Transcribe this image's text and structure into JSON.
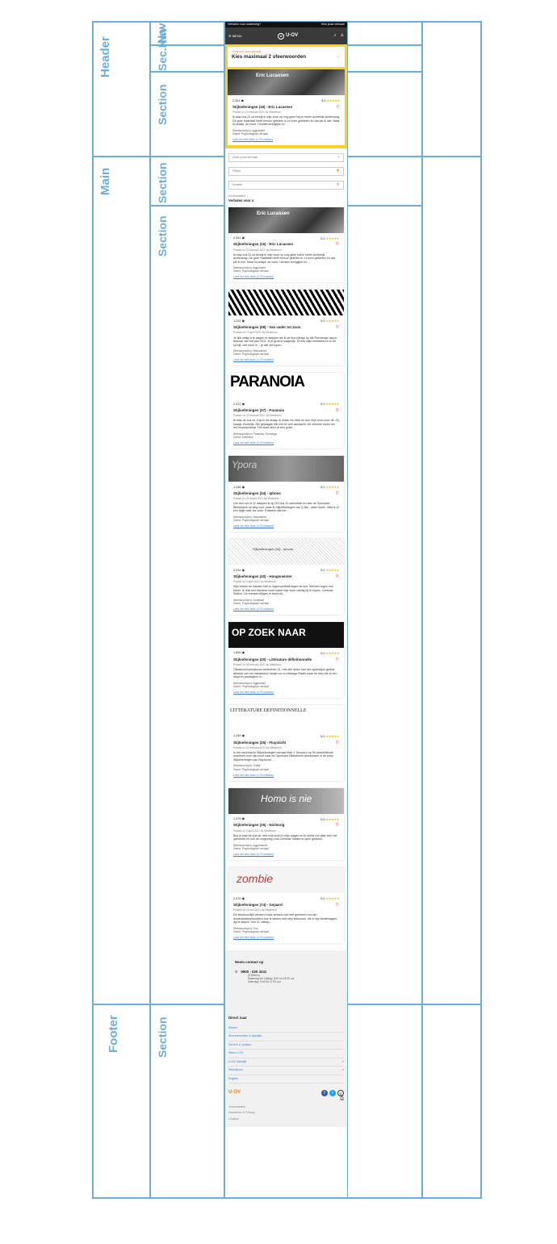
{
  "labels": {
    "header": "Header",
    "main": "Main",
    "footer": "Footer",
    "nav": "Nav",
    "secnav": "Sec.Nav",
    "section": "Section"
  },
  "topbar": {
    "left": "Verhalen voor onderweg?",
    "right": "Kies jouw verhaal!"
  },
  "navbar": {
    "menu": "MENU",
    "logo": "U·OV",
    "icons": [
      "search-icon",
      "user-icon"
    ]
  },
  "picker": {
    "small": "Genereer jouw verhaal",
    "big": "Kies maximaal 2 sfeerwoorden"
  },
  "search": {
    "placeholder": "Zoek jouw verhaal...",
    "filters": "Filters",
    "sort": "Sorteer"
  },
  "results": {
    "count": "54 resultaten",
    "title": "Verhalen voor u"
  },
  "featured": {
    "views": "2.341",
    "rating": "5.0",
    "title": "Stijloefeningen (16) - Eric Lucassen",
    "meta": "Posted on 22 februari 2021 by Medeorch",
    "desc": "Ik stap bus 31 uit terwijl ik mijn zoon op nog geen halve meter Achterlijk achterwolg. De gore Haarstalt heeft eenuur geleden in z'n kom gekliefen en dat pik ik niet. Maar hij slaapt, de hond. Hondes teringlijes en ...",
    "kw": "Sfeerwoord(en): Aggressief",
    "genre": "Genre: Psychologisch verhaal",
    "link": "Lees het hele boek (4,75 minuten)"
  },
  "stories": [
    {
      "img": "Eric Lucassen",
      "views": "2.341",
      "rating": "5.0",
      "title": "Stijloefeningen (16) - Eric Lucassen",
      "meta": "Posted on 22 februari 2021 by Medeorch",
      "desc": "Ik stap bus 31 uit terwijl ik mijn zoon op nog geen halve meter Achterlijk achterwolg. De gore Haarstalt heeft eenuur geleden in z'n kom gekliefen en dat pik ik niet. Maar hij slaapt, de hond. Hondes teringlijes en ...",
      "kw": "Sfeerwoord(en): Aggressief",
      "genre": "Genre: Psychologisch verhaal",
      "link": "Lees het hele boek (4,75 minuten)"
    },
    {
      "img": "",
      "views": "1.222",
      "rating": "5.0",
      "title": "Stijloefeningen (58) - Van vader tot zoon",
      "meta": "Posted on 19 april 2021 by Medeorch",
      "desc": "Je lijkt veilig in je wagen te stappen als ik de bus uitstap op die Ekenlenge dag in februari van het jaar 2011. Ik je groene wagentje. Di een wijle inmiddels nu ik dit schrijf, niet meer in ...je wilt zelf lopen...",
      "kw": "Sfeerwoord(en): Nieuwkierd",
      "genre": "Genre: Psychologisch verhaal",
      "link": "Lees het hele boek (4,75 minuten)"
    },
    {
      "img": "PARANOIA",
      "views": "2.312",
      "rating": "5.0",
      "title": "Stijloefeningen (37) - Paranoia",
      "meta": "Posted on 22 februari 2021 by Medeorch",
      "desc": "Ik stap de bus uit. Kop in de kraag. Ik maak me klein en dun mijn zoon voor dit. Hij kraagt. Eindelijk. Zijn gejaagde blik met te veel aandacht. De mensen lopen ver het moderprobaal. Het wadt allen af een grote...",
      "kw": "Sfeerwoord(en): Paranoia, Onrustige",
      "genre": "Genre: Detective",
      "link": "Lees het hele boek (4,75 minuten)"
    },
    {
      "img": "Ypora",
      "views": "1.248",
      "rating": "5.0",
      "title": "Stijloefeningen (34) - Iphone",
      "meta": "Posted on 22 maart 2021 by Medeorch",
      "desc": "Om een uur of 12 stappen ik op OS bus 31 vanmiddel in naar de Openbare Bibliotheek op weg voor, waar ik Stijloefenfngen van Q.Nie...wilde lenen. Was ik er een tijdje naar toe zoek. Ruitweer dat het...",
      "kw": "Sfeerwoord(en): Nieuwkierd",
      "genre": "Genre: Psychologisch verhaal",
      "link": "Lees het hele boek (4,75 minuten)"
    },
    {
      "img": "Stijloefeningen (34) - Iphone",
      "views": "2.291",
      "rating": "5.0",
      "title": "Stijloefeningen (40) - Hongerwinter",
      "meta": "Posted on 4 april 2021 by Medeorch",
      "desc": "Mijn voeten en handen heb ik ingevroedfeidt tegen de kou. Mensen tegen ons besef. Ik duw een handkar voort naast mijn zoon vanilig bij te kopen. Centraal Station. De mensen lijfigen er lewol bij...",
      "kw": "Sfeerwoord(en): Sombaar",
      "genre": "Genre: Psychologisch verhaal",
      "link": "Lees het hele boek (4,75 minuten)"
    },
    {
      "img": "OP ZOEK NAAR",
      "views": "1.826",
      "rating": "5.0",
      "title": "Stijloefeningen (20) - Littérature définitionnelle",
      "meta": "Posted on 28 februari 2021 by Medeorch",
      "desc": "Olindenvervoersjboom bellentrein 31, met alle delen van het opperwijze getilde afstand van het middelstuin hanslt uur to middags Plaats waar de trein die al een stopt en passagiers in...",
      "kw": "Sfeerwoord(en): Aggressief",
      "genre": "Genre: Psychologisch verhaal",
      "link": "Lees het hele boek (4,75 minuten)"
    },
    {
      "img": "LITTERATURE DEFINITIONNELLE",
      "views": "1.249",
      "rating": "5.0",
      "title": "Stijloefeningen (25) - Fluysticht",
      "meta": "Posted on 22 februari 2021 by Medeorch",
      "desc": "In het wereldzicht Stijloefeningen verhaal Mae J. Moonich op 99 verschillende manieren over zijn tocht naar de Openbare Bibliotheek Amsterdam in de koep Stijloefeningen van Raymond...",
      "kw": "Sfeerwoord(en): Vrolijk",
      "genre": "Genre: Psychologisch verhaal",
      "link": "Lees het hele boek (4,75 minuten)"
    },
    {
      "img": "Homo is nie",
      "views": "1.479",
      "rating": "5.0",
      "title": "Stijloefeningen (26) - Nichtsrig",
      "meta": "Posted on 9 april 2021 by Medeorch",
      "desc": "Bus ik stap de bus uit, met mijn zoon in mijn wagen en ik schrik me daar toch het openbare en ook de omgeving rond Centraal Station is open gebruikt.",
      "kw": "Sfeerwoord(en): Aggressieve",
      "genre": "Genre: Psychologisch verhaal",
      "link": "Lees het hele boek (4,75 minuten)"
    },
    {
      "img": "zombie",
      "views": "2.370",
      "rating": "5.0",
      "title": "Stijloefeningen (74) - Gejaard",
      "meta": "Posted on 23 mei 2021 by Medeorch",
      "desc": "De steuthoorlijkt verwerd maar iemand ook heft geïnteerd via zijn achterdubbepreputition hoe is samen met mijn kleinzoon, die in zijn kinderwagen ligt te slapen, bus 31 uitstap...",
      "kw": "Sfeerwoord(en): Duo",
      "genre": "Genre: Psychologisch verhaal",
      "link": "Lees het hele boek (4,75 minuten)"
    }
  ],
  "footer": {
    "contact_title": "Neem contact op",
    "phone": "0900 - 020 3241",
    "hours": [
      "(0,09/min)",
      "Maandag t/m vrijdag: 8:00 tot 23:00 uur",
      "Zaterdag: 9:00 tot 17:00 uur"
    ],
    "direct_title": "Direct naar",
    "links": [
      {
        "label": "Reizen",
        "ext": ""
      },
      {
        "label": "Abonnementen & kaartjes",
        "ext": ""
      },
      {
        "label": "Service & contact",
        "ext": ""
      },
      {
        "label": "Werk U-OV",
        "ext": ""
      },
      {
        "label": "U-OV Zakelijk",
        "ext": "↗"
      },
      {
        "label": "Werk@uov",
        "ext": "↗"
      },
      {
        "label": "English",
        "ext": ""
      }
    ],
    "logo": "U·OV",
    "legal": [
      "Voorwaarden",
      "Disclaimer & Privacy",
      "Cookies"
    ]
  }
}
